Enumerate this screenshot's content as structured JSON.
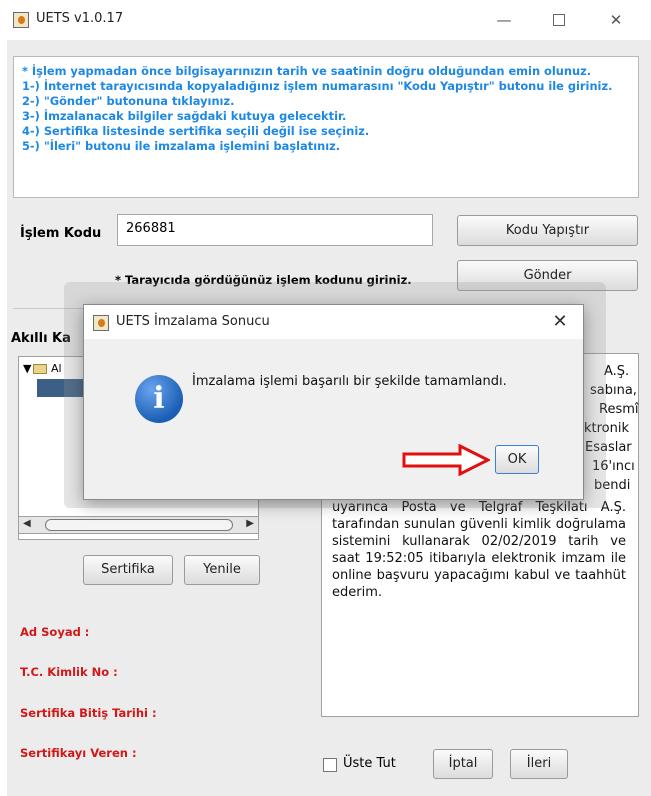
{
  "window": {
    "title": "UETS v1.0.17",
    "min_glyph": "—",
    "close_glyph": "✕"
  },
  "info_box": {
    "lines": [
      "* İşlem yapmadan önce bilgisayarınızın tarih ve saatinin doğru olduğundan emin olunuz.",
      "1-) İnternet tarayıcısında kopyaladığınız işlem numarasını \"Kodu Yapıştır\" butonu ile giriniz.",
      "2-) \"Gönder\" butonuna tıklayınız.",
      "3-) İmzalanacak bilgiler sağdaki kutuya gelecektir.",
      "4-) Sertifika listesinde sertifika seçili değil ise seçiniz.",
      "5-) \"İleri\" butonu ile imzalama işlemini başlatınız."
    ]
  },
  "islem": {
    "label": "İşlem Kodu",
    "value": "266881",
    "hint": "* Tarayıcıda gördüğünüz işlem kodunu giriniz."
  },
  "buttons": {
    "kodu_yapistir": "Kodu Yapıştır",
    "gonder": "Gönder",
    "sertifika": "Sertifika",
    "yenile": "Yenile",
    "iptal": "İptal",
    "ileri": "İleri"
  },
  "akilli_label": "Akıllı Ka",
  "tree": {
    "root_label": "Al"
  },
  "fields": {
    "ad_soyad": "Ad Soyad :",
    "tc": "T.C. Kimlik No :",
    "bitis": "Sertifika Bitiş Tarihi :",
    "veren": "Sertifikayı Veren :"
  },
  "text_area": {
    "right_fragments": [
      "A.Ş.",
      "sabına,",
      "Resmî",
      "ktronik",
      "Esaslar",
      "16'ıncı",
      "bendi"
    ],
    "body": "uyarınca Posta ve Telgraf Teşkilatı A.Ş. tarafından sunulan güvenli kimlik doğrulama sistemini kullanarak 02/02/2019 tarih ve saat 19:52:05 itibarıyla elektronik imzam ile online başvuru yapacağımı kabul ve taahhüt ederim."
  },
  "checkbox": {
    "label": "Üste Tut",
    "checked": false
  },
  "dialog": {
    "title": "UETS İmzalama Sonucu",
    "message": "İmzalama işlemi başarılı bir şekilde tamamlandı.",
    "ok_label": "OK",
    "icon_glyph": "i",
    "close_glyph": "✕"
  },
  "colors": {
    "info_text": "#1e88e5",
    "field_label": "#d01818",
    "arrow": "#e01010",
    "selection": "#3c5f86"
  }
}
